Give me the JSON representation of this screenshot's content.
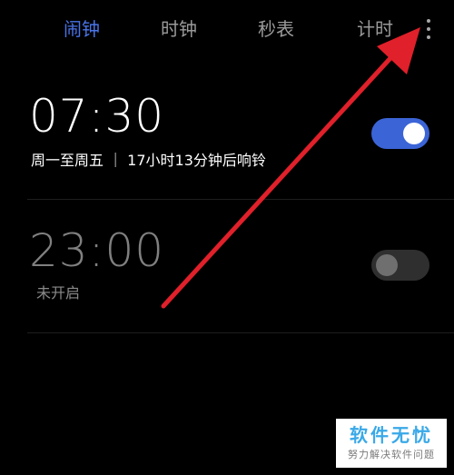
{
  "tabs": [
    {
      "label": "闹钟",
      "active": true
    },
    {
      "label": "时钟",
      "active": false
    },
    {
      "label": "秒表",
      "active": false
    },
    {
      "label": "计时",
      "active": false
    }
  ],
  "alarms": [
    {
      "time": "07:30",
      "subtitle": "周一至周五 ｜ 17小时13分钟后响铃",
      "enabled": true
    },
    {
      "time": "23:00",
      "subtitle": "未开启",
      "enabled": false
    }
  ],
  "watermark": {
    "title": "软件无忧",
    "subtitle": "努力解决软件问题"
  },
  "colors": {
    "background": "#000000",
    "accent": "#4a74e8",
    "toggle_on": "#3b64d6",
    "annotation_arrow": "#e0202a"
  },
  "icons": {
    "overflow_menu": "vertical-ellipsis-icon"
  }
}
